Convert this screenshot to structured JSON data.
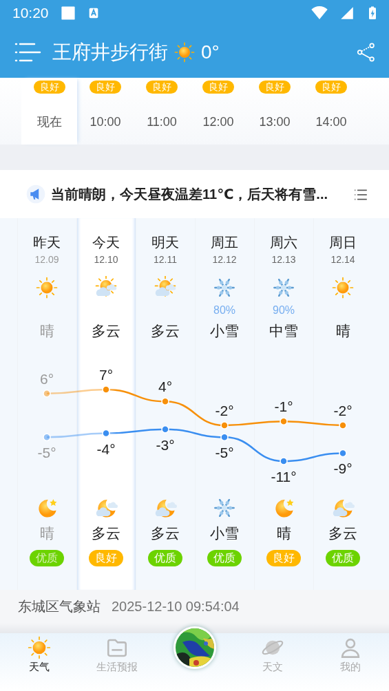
{
  "status_bar": {
    "time": "10:20"
  },
  "header": {
    "location": "王府井步行街",
    "temperature": "0°"
  },
  "hourly": [
    {
      "time": "现在",
      "selected": true,
      "aqi": {
        "label": "良好",
        "color": "#ffb800"
      }
    },
    {
      "time": "10:00",
      "selected": false,
      "aqi": {
        "label": "良好",
        "color": "#ffb800"
      }
    },
    {
      "time": "11:00",
      "selected": false,
      "aqi": {
        "label": "良好",
        "color": "#ffb800"
      }
    },
    {
      "time": "12:00",
      "selected": false,
      "aqi": {
        "label": "良好",
        "color": "#ffb800"
      }
    },
    {
      "time": "13:00",
      "selected": false,
      "aqi": {
        "label": "良好",
        "color": "#ffb800"
      }
    },
    {
      "time": "14:00",
      "selected": false,
      "aqi": {
        "label": "良好",
        "color": "#ffb800"
      }
    }
  ],
  "announcement": {
    "text": "当前晴朗，今天昼夜温差11℃，后天将有雪..."
  },
  "daily": [
    {
      "name": "昨天",
      "date": "12.09",
      "past": true,
      "selected": false,
      "day": {
        "kind": "sun",
        "label": "晴"
      },
      "high": "6°",
      "low": "-5°",
      "night": {
        "kind": "moon",
        "label": "晴"
      },
      "aqi": {
        "label": "优质",
        "color": "#6cd300"
      }
    },
    {
      "name": "今天",
      "date": "12.10",
      "past": false,
      "selected": true,
      "day": {
        "kind": "sun-cloud",
        "label": "多云"
      },
      "high": "7°",
      "low": "-4°",
      "night": {
        "kind": "moon-cloud",
        "label": "多云"
      },
      "aqi": {
        "label": "良好",
        "color": "#ffb800"
      }
    },
    {
      "name": "明天",
      "date": "12.11",
      "past": false,
      "selected": false,
      "day": {
        "kind": "sun-cloud",
        "label": "多云"
      },
      "high": "4°",
      "low": "-3°",
      "night": {
        "kind": "moon-cloud",
        "label": "多云"
      },
      "aqi": {
        "label": "优质",
        "color": "#6cd300"
      }
    },
    {
      "name": "周五",
      "date": "12.12",
      "past": false,
      "selected": false,
      "day": {
        "kind": "snow",
        "label": "小雪",
        "chance": "80%"
      },
      "high": "-2°",
      "low": "-5°",
      "night": {
        "kind": "snow",
        "label": "小雪"
      },
      "aqi": {
        "label": "优质",
        "color": "#6cd300"
      }
    },
    {
      "name": "周六",
      "date": "12.13",
      "past": false,
      "selected": false,
      "day": {
        "kind": "snow",
        "label": "中雪",
        "chance": "90%"
      },
      "high": "-1°",
      "low": "-11°",
      "night": {
        "kind": "moon",
        "label": "晴"
      },
      "aqi": {
        "label": "良好",
        "color": "#ffb800"
      }
    },
    {
      "name": "周日",
      "date": "12.14",
      "past": false,
      "selected": false,
      "day": {
        "kind": "sun",
        "label": "晴"
      },
      "high": "-2°",
      "low": "-9°",
      "night": {
        "kind": "moon-cloud",
        "label": "多云"
      },
      "aqi": {
        "label": "优质",
        "color": "#6cd300"
      }
    }
  ],
  "station": {
    "name": "东城区气象站",
    "updated": "2025-12-10 09:54:04"
  },
  "nav": [
    {
      "kind": "sun",
      "label": "天气",
      "selected": true
    },
    {
      "kind": "folder",
      "label": "生活预报",
      "selected": false
    },
    {
      "kind": "radar"
    },
    {
      "kind": "planet",
      "label": "天文",
      "selected": false
    },
    {
      "kind": "person",
      "label": "我的",
      "selected": false
    }
  ]
}
